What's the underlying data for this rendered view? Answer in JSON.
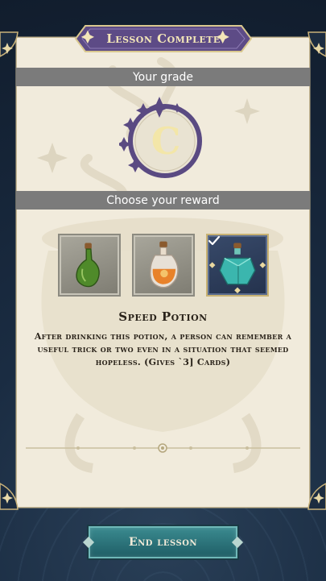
{
  "header": {
    "title": "Lesson Complete"
  },
  "grade": {
    "label": "Your grade",
    "value": "C"
  },
  "reward": {
    "label": "Choose your reward",
    "options": [
      {
        "name": "green-potion",
        "selected": false
      },
      {
        "name": "orange-potion",
        "selected": false
      },
      {
        "name": "speed-potion",
        "selected": true
      }
    ],
    "selected_title": "Speed Potion",
    "selected_description": "After drinking this potion, a person can remember a useful trick or two even in a situation that seemed hopeless. (Gives `3] Cards)"
  },
  "footer": {
    "end_label": "End lesson"
  },
  "colors": {
    "banner": "#5d4b86",
    "grade_ring": "#5a4a82",
    "grade_letter": "#f3e6a8",
    "bar": "#7b7b7b",
    "button": "#2b7479"
  },
  "icons": [
    "sparkle-icon",
    "check-icon",
    "diamond-ornament-icon"
  ]
}
